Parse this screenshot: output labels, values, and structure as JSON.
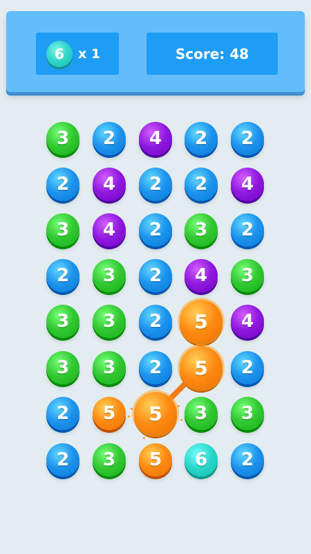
{
  "header": {
    "combo_value": "6",
    "combo_multiplier": "x 1",
    "score_label": "Score: 48"
  },
  "colors": {
    "2": "#1d93ee",
    "3": "#31c832",
    "4": "#8f19df",
    "5": "#ff8a12",
    "6": "#2bd6c9"
  },
  "grid": [
    [
      "3",
      "2",
      "4",
      "2",
      "2"
    ],
    [
      "2",
      "4",
      "2",
      "2",
      "4"
    ],
    [
      "3",
      "4",
      "2",
      "3",
      "2"
    ],
    [
      "2",
      "3",
      "2",
      "4",
      "3"
    ],
    [
      "3",
      "3",
      "2",
      "5",
      "4"
    ],
    [
      "3",
      "3",
      "2",
      "5",
      "2"
    ],
    [
      "2",
      "5",
      "5",
      "3",
      "3"
    ],
    [
      "2",
      "3",
      "5",
      "6",
      "2"
    ]
  ],
  "selected_path": [
    [
      4,
      3
    ],
    [
      5,
      3
    ],
    [
      6,
      2
    ]
  ]
}
